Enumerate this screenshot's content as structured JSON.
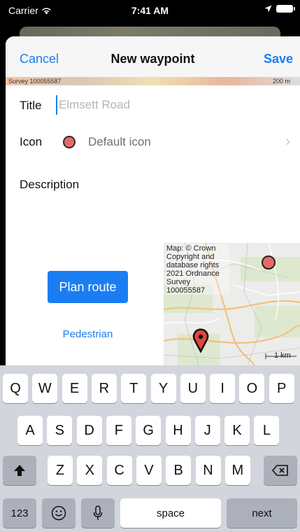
{
  "status_bar": {
    "carrier": "Carrier",
    "time": "7:41 AM"
  },
  "nav": {
    "cancel": "Cancel",
    "title": "New waypoint",
    "save": "Save"
  },
  "map_strip": {
    "left_text": "Survey 100055587",
    "right_text": "200 m"
  },
  "form": {
    "title_label": "Title",
    "title_placeholder": "Elmsett Road",
    "title_value": "",
    "icon_label": "Icon",
    "icon_value": "Default icon",
    "icon_color": "#e46a6a",
    "description_label": "Description",
    "description_value": ""
  },
  "plan_route": {
    "button": "Plan route",
    "mode": "Pedestrian"
  },
  "mini_map": {
    "attribution": "Map: © Crown Copyright and database rights 2021 Ordnance Survey 100055587",
    "scale": "1 km"
  },
  "keyboard": {
    "row1": [
      "Q",
      "W",
      "E",
      "R",
      "T",
      "Y",
      "U",
      "I",
      "O",
      "P"
    ],
    "row2": [
      "A",
      "S",
      "D",
      "F",
      "G",
      "H",
      "J",
      "K",
      "L"
    ],
    "row3": [
      "Z",
      "X",
      "C",
      "V",
      "B",
      "N",
      "M"
    ],
    "numbers_key": "123",
    "space_key": "space",
    "return_key": "next"
  },
  "colors": {
    "accent": "#1a7ef2",
    "pin": "#e46a6a"
  }
}
